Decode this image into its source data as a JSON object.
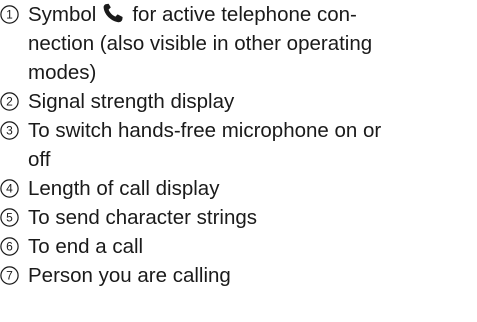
{
  "legend": [
    {
      "number": "1",
      "lines_before_icon": "Symbol",
      "icon": "phone-handset-icon",
      "lines_after_icon": "for active telephone con-",
      "lines": [
        "nection (also visible in other operating",
        "modes)"
      ]
    },
    {
      "number": "2",
      "lines": [
        "Signal strength display"
      ]
    },
    {
      "number": "3",
      "lines": [
        "To switch hands-free microphone on or",
        "off"
      ]
    },
    {
      "number": "4",
      "lines": [
        "Length of call display"
      ]
    },
    {
      "number": "5",
      "lines": [
        "To send character strings"
      ]
    },
    {
      "number": "6",
      "lines": [
        "To end a call"
      ]
    },
    {
      "number": "7",
      "lines": [
        "Person you are calling"
      ]
    }
  ]
}
